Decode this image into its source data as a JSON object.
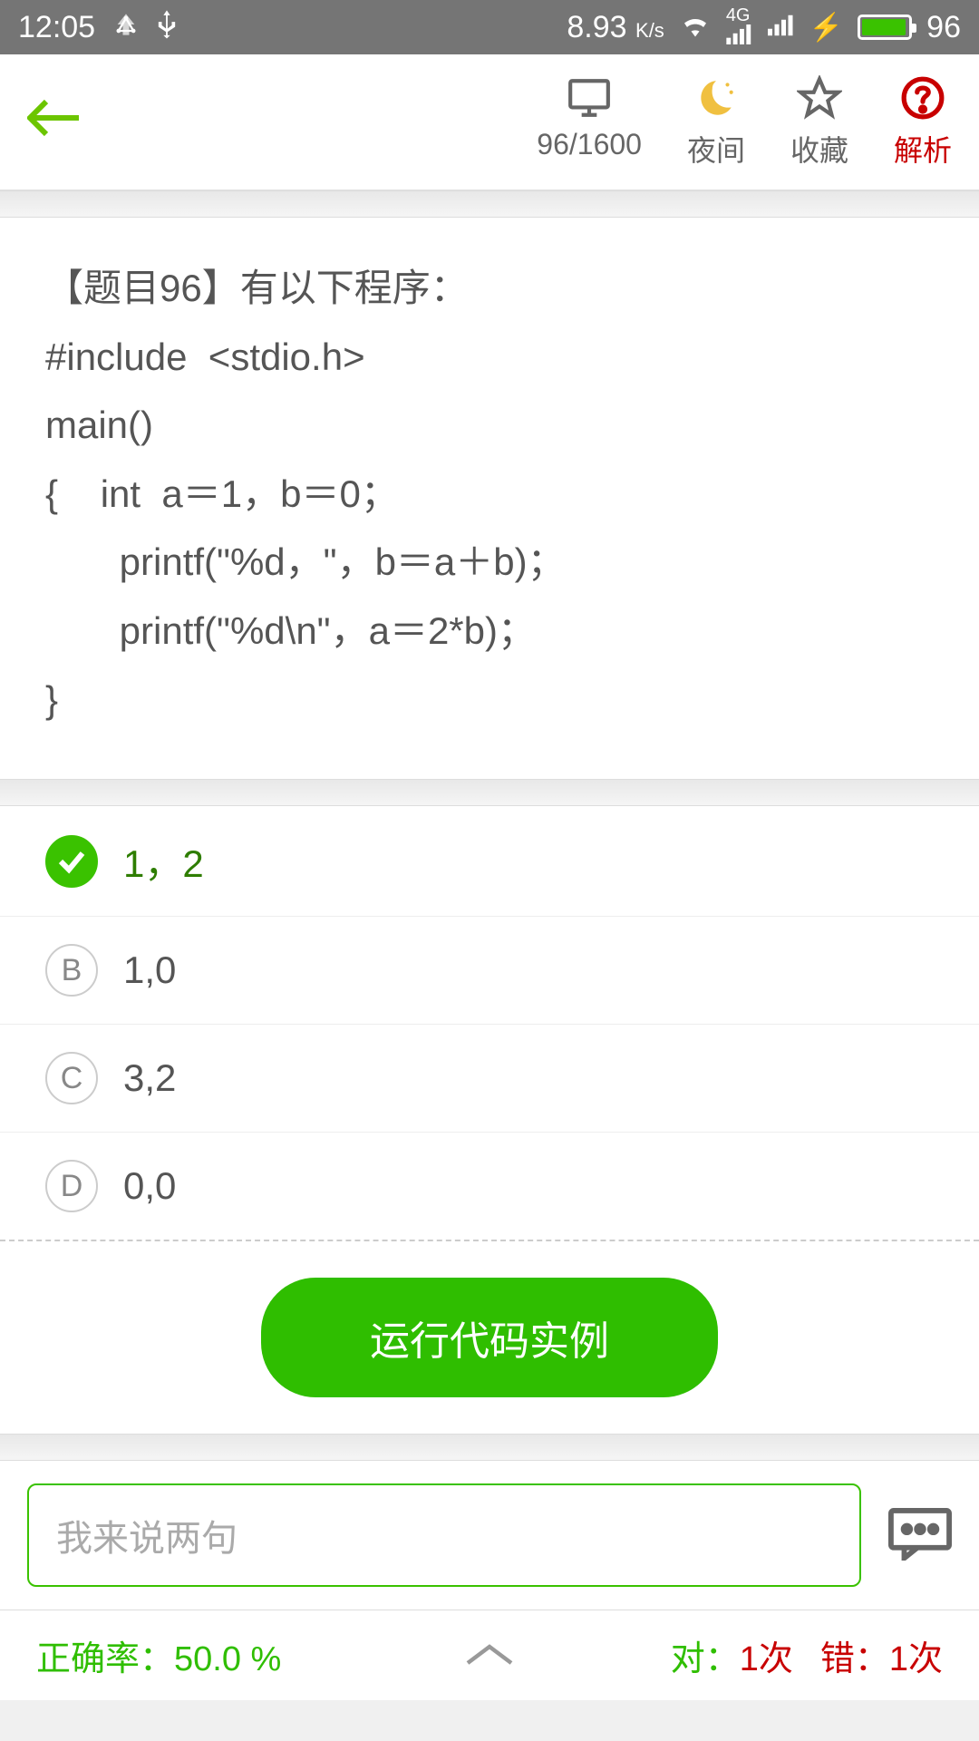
{
  "status": {
    "time": "12:05",
    "speed": "8.93",
    "speed_unit": "K/s",
    "battery": "96"
  },
  "toolbar": {
    "counter": "96/1600",
    "night": "夜间",
    "favorite": "收藏",
    "analysis": "解析"
  },
  "question": {
    "title": "【题目96】有以下程序：",
    "lines": [
      "#include  <stdio.h>",
      "main()",
      "{    int  a＝1，b＝0；",
      "       printf(\"%d，\"，b＝a＋b)；",
      "       printf(\"%d\\n\"，a＝2*b)；",
      "}"
    ]
  },
  "options": [
    {
      "label": "✓",
      "text": "1，2",
      "correct": true
    },
    {
      "label": "B",
      "text": "1,0",
      "correct": false
    },
    {
      "label": "C",
      "text": "3,2",
      "correct": false
    },
    {
      "label": "D",
      "text": "0,0",
      "correct": false
    }
  ],
  "run_button": "运行代码实例",
  "comment_placeholder": "我来说两句",
  "stats": {
    "accuracy_label": "正确率：",
    "accuracy_value": "50.0 %",
    "correct_label": "对：",
    "correct_value": "1次",
    "wrong_label": "错：",
    "wrong_value": "1次"
  }
}
